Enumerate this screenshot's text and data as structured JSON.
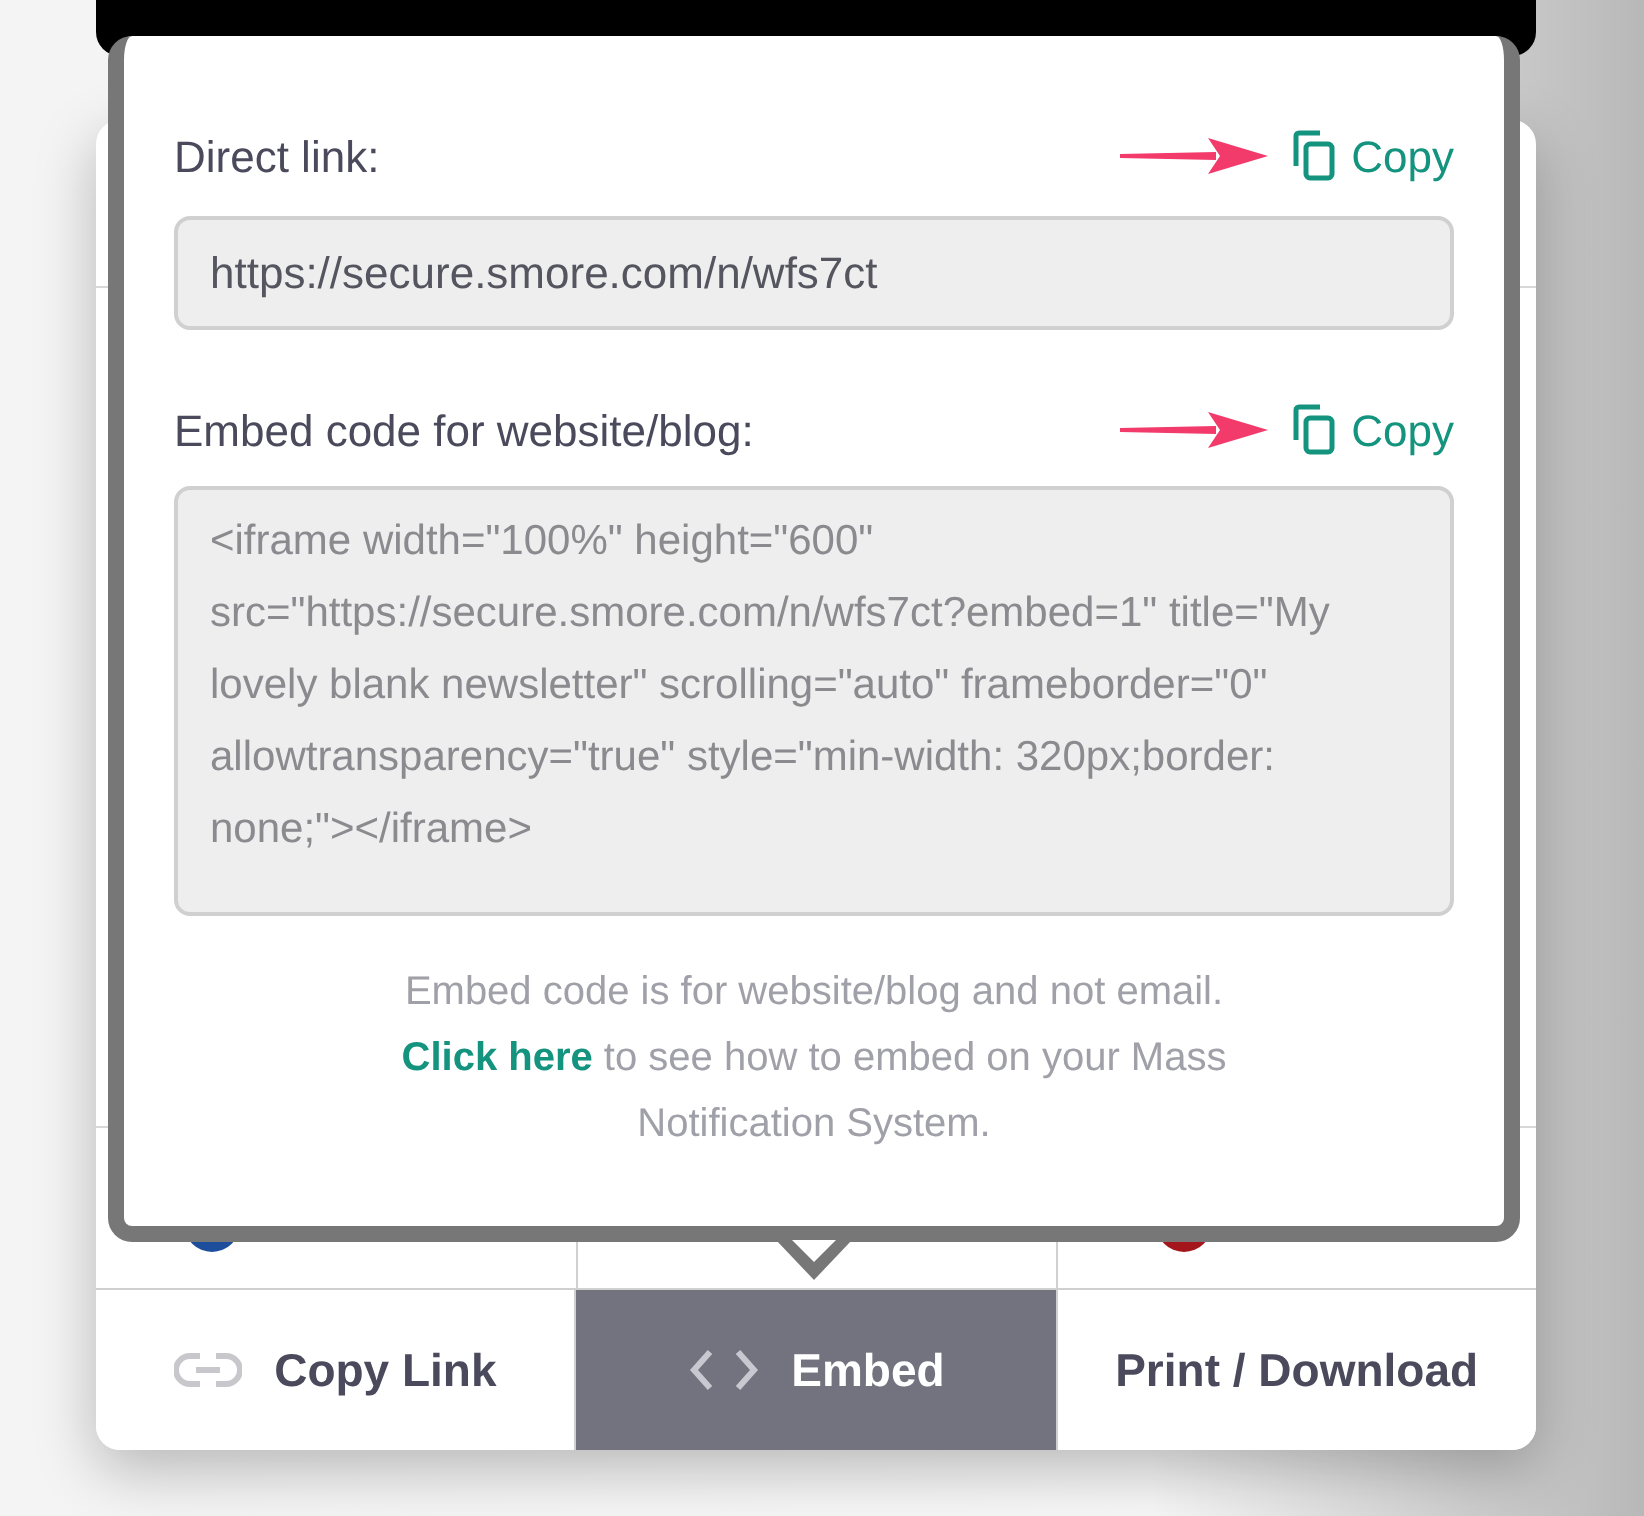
{
  "popover": {
    "direct_link": {
      "label": "Direct link:",
      "copy": "Copy",
      "value": "https://secure.smore.com/n/wfs7ct"
    },
    "embed_code": {
      "label": "Embed code for website/blog:",
      "copy": "Copy",
      "value": "<iframe width=\"100%\" height=\"600\" src=\"https://secure.smore.com/n/wfs7ct?embed=1\" title=\"My lovely blank newsletter\" scrolling=\"auto\" frameborder=\"0\" allowtransparency=\"true\" style=\"min-width: 320px;border: none;\"></iframe>"
    },
    "note": {
      "before": "Embed code is for website/blog and not email.",
      "link": "Click here",
      "after": "to see how to embed on your Mass Notification System."
    }
  },
  "share_tabs": [
    {
      "label": "Copy Link",
      "kind": "link",
      "selected": false
    },
    {
      "label": "Embed",
      "kind": "code",
      "selected": true
    },
    {
      "label": "Print / Download",
      "kind": "print",
      "selected": false
    }
  ]
}
